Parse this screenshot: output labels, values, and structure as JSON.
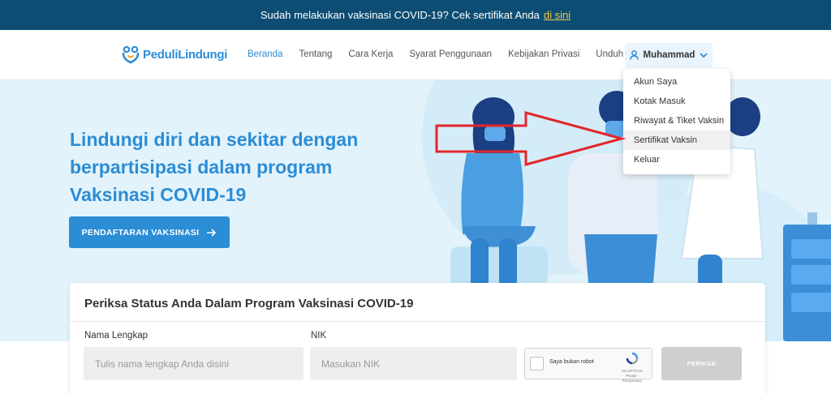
{
  "announcement": {
    "text": "Sudah melakukan vaksinasi COVID-19? Cek sertifikat Anda",
    "link": "di sini"
  },
  "nav": {
    "logo": "PeduliLindungi",
    "links": [
      "Beranda",
      "Tentang",
      "Cara Kerja",
      "Syarat Penggunaan",
      "Kebijakan Privasi",
      "Unduh"
    ],
    "user_name": "Muhammad"
  },
  "dropdown": {
    "items": [
      "Akun Saya",
      "Kotak Masuk",
      "Riwayat & Tiket Vaksin",
      "Sertifikat Vaksin",
      "Keluar"
    ]
  },
  "hero": {
    "title": "Lindungi diri dan sekitar dengan berpartisipasi dalam program Vaksinasi COVID-19",
    "button": "PENDAFTARAN VAKSINASI"
  },
  "status_card": {
    "title": "Periksa Status Anda Dalam Program Vaksinasi COVID-19",
    "name_label": "Nama Lengkap",
    "name_placeholder": "Tulis nama lengkap Anda disini",
    "nik_label": "NIK",
    "nik_placeholder": "Masukan NIK",
    "captcha_text": "Saya bukan robot",
    "captcha_brand": "reCAPTCHA",
    "captcha_links": "Privasi - Persyaratan",
    "submit": "PERIKSA"
  },
  "colors": {
    "announce_bg": "#0d4d73",
    "brand_blue": "#2b8dd6",
    "hero_bg": "#e3f3fb",
    "annotation_red": "#e3262b"
  }
}
